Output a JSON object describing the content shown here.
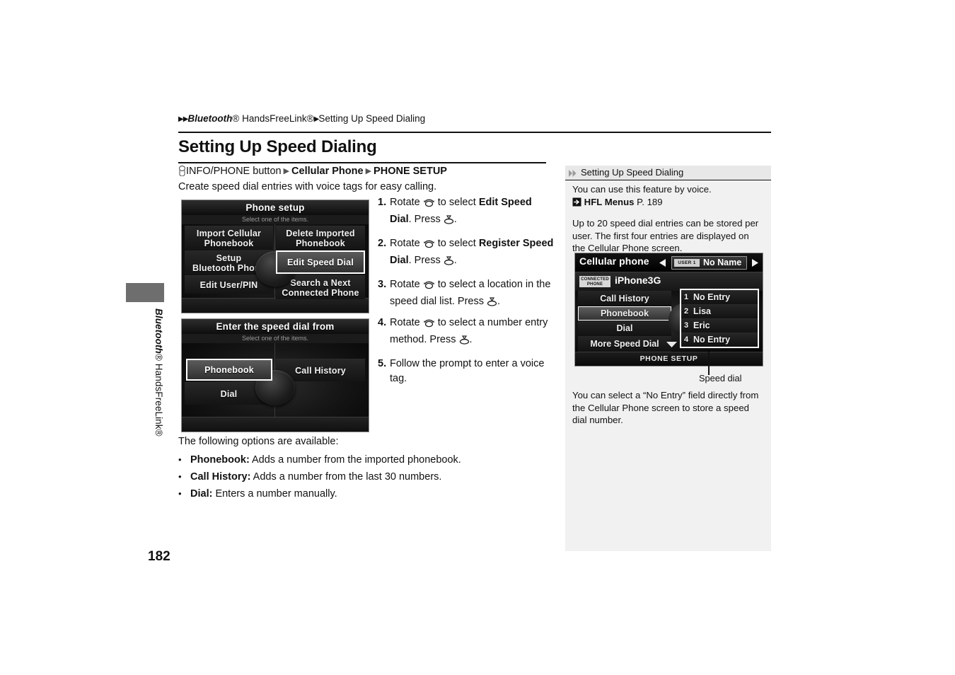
{
  "book": {
    "section_vertical_label_italic": "Bluetooth",
    "section_vertical_label_rest": "® HandsFreeLink®",
    "page_number": "182"
  },
  "breadcrumb": {
    "arrow1": "▶",
    "arrow2": "▶",
    "item_italic": "Bluetooth",
    "item_rest": "® HandsFreeLink®",
    "current": "Setting Up Speed Dialing"
  },
  "header": {
    "title": "Setting Up Speed Dialing"
  },
  "navpath": {
    "knob_icon": "rotary-knob-icon",
    "button": "INFO/PHONE button",
    "sep1": "▶",
    "item1": "Cellular Phone",
    "sep2": "▶",
    "item2": "PHONE SETUP"
  },
  "intro": "Create speed dial entries with voice tags for easy calling.",
  "screens": {
    "phone_setup": {
      "title": "Phone setup",
      "subtitle": "Select one of the items.",
      "items": [
        {
          "label": "Import Cellular\nPhonebook",
          "selected": false
        },
        {
          "label": "Delete Imported\nPhonebook",
          "selected": false
        },
        {
          "label": "Setup\nBluetooth Phone",
          "selected": false
        },
        {
          "label": "Edit Speed Dial",
          "selected": true
        },
        {
          "label": "Edit User/PIN",
          "selected": false
        },
        {
          "label": "Search a Next\nConnected Phone",
          "selected": false
        }
      ]
    },
    "speed_dial_from": {
      "title": "Enter the speed dial from",
      "subtitle": "Select one of the items.",
      "items": [
        {
          "label": "Phonebook",
          "selected": true
        },
        {
          "label": "Call History",
          "selected": false
        },
        {
          "label": "Dial",
          "selected": false
        }
      ]
    },
    "cellular_phone": {
      "title": "Cellular phone",
      "user_badge": "USER 1",
      "user_name": "No Name",
      "connected_label_line1": "CONNECTED",
      "connected_label_line2": "PHONE",
      "connected_phone": "iPhone3G",
      "left_menu": [
        {
          "label": "Call History",
          "selected": false
        },
        {
          "label": "Phonebook",
          "selected": true
        },
        {
          "label": "Dial",
          "selected": false
        },
        {
          "label": "More Speed Dial",
          "selected": false
        }
      ],
      "speed_dial_entries": [
        {
          "num": "1",
          "label": "No Entry"
        },
        {
          "num": "2",
          "label": "Lisa"
        },
        {
          "num": "3",
          "label": "Eric"
        },
        {
          "num": "4",
          "label": "No Entry"
        }
      ],
      "footer": "PHONE SETUP",
      "caption": "Speed dial"
    }
  },
  "steps": [
    {
      "n": "1.",
      "pre": "Rotate ",
      "icon1": "rotate-knob-icon",
      "mid": " to select ",
      "bold": "Edit Speed Dial",
      "post": ". Press ",
      "icon2": "press-knob-icon",
      "end": "."
    },
    {
      "n": "2.",
      "pre": "Rotate ",
      "icon1": "rotate-knob-icon",
      "mid": " to select ",
      "bold": "Register Speed Dial",
      "post": ". Press ",
      "icon2": "press-knob-icon",
      "end": "."
    },
    {
      "n": "3.",
      "pre": "Rotate ",
      "icon1": "rotate-knob-icon",
      "mid": " to select a location in the speed dial list. Press ",
      "bold": "",
      "post": "",
      "icon2": "press-knob-icon",
      "end": "."
    }
  ],
  "steps2": [
    {
      "n": "4.",
      "pre": "Rotate ",
      "icon1": "rotate-knob-icon",
      "mid": " to select a number entry method. Press ",
      "icon2": "press-knob-icon",
      "end": "."
    },
    {
      "n": "5.",
      "pre": "Follow the prompt to enter a voice tag.",
      "icon1": "",
      "mid": "",
      "icon2": "",
      "end": ""
    }
  ],
  "options": {
    "intro": "The following options are available:",
    "items": [
      {
        "bullet": "•",
        "term": "Phonebook:",
        "desc": " Adds a number from the imported phonebook."
      },
      {
        "bullet": "•",
        "term": "Call History:",
        "desc": " Adds a number from the last 30 numbers."
      },
      {
        "bullet": "•",
        "term": "Dial:",
        "desc": " Enters a number manually."
      }
    ]
  },
  "note": {
    "head_icon": "double-chevron-icon",
    "head_title": "Setting Up Speed Dialing",
    "p1": "You can use this feature by voice.",
    "ref_icon": "jump-arrow-icon",
    "ref_bold": "HFL Menus",
    "ref_page": "P. 189",
    "p2": "Up to 20 speed dial entries can be stored per user. The first four entries are displayed on the Cellular Phone screen.",
    "p3": "You can select a “No Entry” field directly from the Cellular Phone screen to store a speed dial number."
  },
  "colors": {
    "page_bg": "#ffffff",
    "note_bg": "#f1f1f1",
    "note_head_bg": "#e8e8e8",
    "tab_gray": "#6e6e6e",
    "text": "#111111",
    "screen_black": "#000000"
  }
}
